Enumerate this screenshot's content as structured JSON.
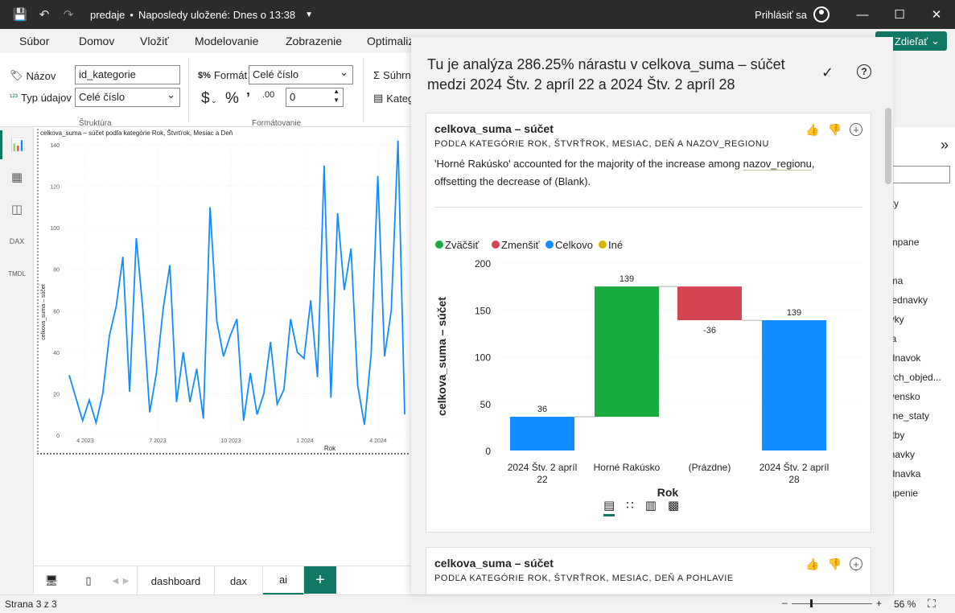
{
  "titlebar": {
    "filename": "predaje",
    "saved": "Naposledy uložené: Dnes o 13:38",
    "signin": "Prihlásiť sa"
  },
  "ribbon_tabs": [
    "Súbor",
    "Domov",
    "Vložiť",
    "Modelovanie",
    "Zobrazenie",
    "Optimaliz"
  ],
  "share_label": "Zdieľať",
  "ribbon": {
    "name_label": "Názov",
    "name_value": "id_kategorie",
    "type_label": "Typ údajov",
    "type_value": "Celé číslo",
    "format_label": "Formát",
    "format_value": "Celé číslo",
    "decimal_value": "0",
    "group_structure": "Štruktúra",
    "group_format": "Formátovanie",
    "summ_label": "Súhrn",
    "categ_label": "Kateg"
  },
  "background_chart": {
    "title": "celkova_suma – súčet podľa kategórie Rok, Štvrťrok, Mesiac a Deň",
    "ylabel": "celkova_suma – súčet",
    "xlabel": "Rok",
    "yticks": [
      "140",
      "120",
      "100",
      "80",
      "60",
      "40",
      "20",
      "0"
    ],
    "xticks": [
      "4 2023",
      "7 2023",
      "10 2023",
      "1 2024",
      "4 2024"
    ],
    "series": [
      29,
      18,
      7,
      17,
      6,
      20,
      48,
      62,
      86,
      21,
      95,
      60,
      11,
      30,
      61,
      82,
      16,
      40,
      16,
      32,
      8,
      110,
      55,
      38,
      48,
      56,
      7,
      30,
      10,
      20,
      45,
      15,
      22,
      56,
      40,
      37,
      65,
      28,
      130,
      18,
      107,
      70,
      90,
      24,
      5,
      39,
      125,
      38,
      60,
      142,
      10
    ]
  },
  "page_tabs": [
    "dashboard",
    "dax",
    "ai"
  ],
  "status": {
    "page": "Strana 3 z 3",
    "zoom": "56 %"
  },
  "right_pane_items": [
    "vky",
    "ampane",
    "uma",
    "ojednavky",
    "avky",
    "ika",
    "ednavok",
    "kych_objed...",
    "ovensko",
    "rane_staty",
    "latby",
    "dnavky",
    "ednavka",
    "kupenie",
    "y"
  ],
  "popup": {
    "title": "Tu je analýza 286.25% nárastu v celkova_suma – súčet medzi 2024 Štv. 2 apríl 22 a 2024 Štv. 2 apríl 28",
    "card1": {
      "title": "celkova_suma – súčet",
      "subtitle": "PODĽA KATEGÓRIE ROK, ŠTVRŤROK, MESIAC, DEŇ A NAZOV_REGIONU",
      "desc_part1": "'Horné Rakúsko' accounted for the majority of the increase among ",
      "desc_field": "nazov_regionu",
      "desc_part2": ", offsetting the decrease of (Blank)."
    },
    "card2": {
      "title": "celkova_suma – súčet",
      "subtitle": "PODĽA KATEGÓRIE ROK, ŠTVRŤROK, MESIAC, DEŇ A POHLAVIE"
    }
  },
  "chart_data": {
    "type": "bar",
    "subtype": "waterfall",
    "categories": [
      "2024 Štv. 2 apríl 22",
      "Horné Rakúsko",
      "(Prázdne)",
      "2024 Štv. 2 apríl 28"
    ],
    "values": [
      36,
      139,
      -36,
      139
    ],
    "data_labels": [
      "36",
      "139",
      "-36",
      "139"
    ],
    "bar_kinds": [
      "total",
      "increase",
      "decrease",
      "total"
    ],
    "xlabel": "Rok",
    "ylabel": "celkova_suma – súčet",
    "ylim": [
      0,
      200
    ],
    "yticks": [
      0,
      50,
      100,
      150,
      200
    ],
    "legend": [
      {
        "name": "Zväčšiť",
        "color": "#1aab40"
      },
      {
        "name": "Zmenšiť",
        "color": "#d64554"
      },
      {
        "name": "Celkovo",
        "color": "#118dff"
      },
      {
        "name": "Iné",
        "color": "#d9b300"
      }
    ],
    "legend_position": "top-left",
    "grid": true
  }
}
